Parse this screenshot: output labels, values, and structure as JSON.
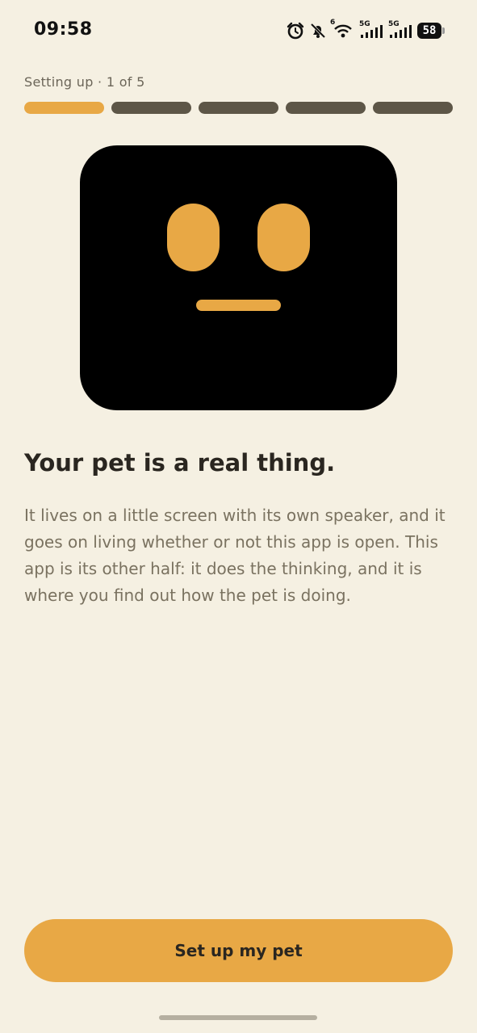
{
  "status_bar": {
    "time": "09:58",
    "network_labels": [
      "5G",
      "5G"
    ],
    "wifi_badge": "6",
    "battery": "58",
    "icons": [
      "alarm-icon",
      "bell-off-icon",
      "wifi-icon",
      "signal-5g-icon",
      "signal-5g-icon",
      "battery-icon"
    ]
  },
  "onboarding": {
    "step_label": "Setting up · 1 of 5",
    "steps_total": 5,
    "current_step": 1,
    "title": "Your pet is a real thing.",
    "body": "It lives on a little screen with its own speaker, and it goes on living whether or not this app is open. This app is its other half: it does the thinking, and it is where you find out how the pet is doing.",
    "cta_label": "Set up my pet"
  },
  "colors": {
    "background": "#f5f0e2",
    "accent": "#e8a845",
    "progress_inactive": "#5d5647",
    "face": "#000000",
    "title_text": "#2a2620",
    "body_text": "#7a7260"
  }
}
